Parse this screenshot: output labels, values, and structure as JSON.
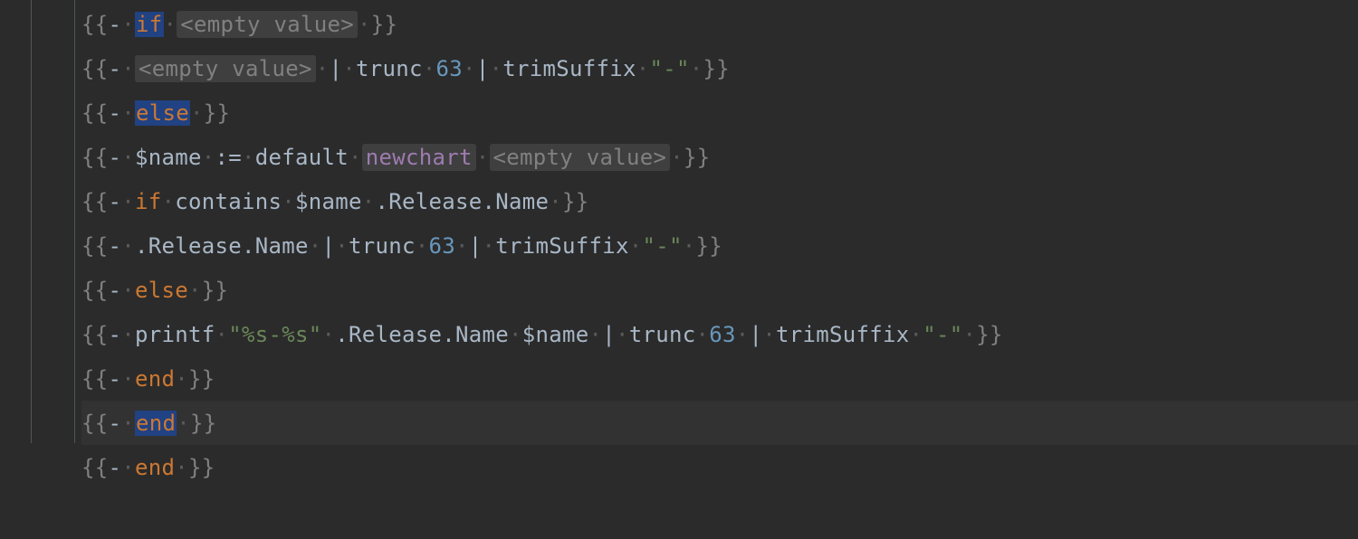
{
  "code": {
    "lines": [
      {
        "active": false,
        "tokens": [
          {
            "cls": "tok-delim",
            "text": "{{"
          },
          {
            "cls": "tok-default",
            "text": "-"
          },
          {
            "cls": "dot",
            "text": "·"
          },
          {
            "cls": "tok-keyword-hl",
            "text": "if"
          },
          {
            "cls": "dot",
            "text": "·"
          },
          {
            "cls": "tok-inlay",
            "text": "<empty value>"
          },
          {
            "cls": "dot",
            "text": "·"
          },
          {
            "cls": "tok-delim",
            "text": "}}"
          }
        ]
      },
      {
        "active": false,
        "tokens": [
          {
            "cls": "tok-delim",
            "text": "{{"
          },
          {
            "cls": "tok-default",
            "text": "-"
          },
          {
            "cls": "dot",
            "text": "·"
          },
          {
            "cls": "tok-inlay",
            "text": "<empty value>"
          },
          {
            "cls": "dot",
            "text": "·"
          },
          {
            "cls": "tok-default",
            "text": "|"
          },
          {
            "cls": "dot",
            "text": "·"
          },
          {
            "cls": "tok-func",
            "text": "trunc"
          },
          {
            "cls": "dot",
            "text": "·"
          },
          {
            "cls": "tok-number",
            "text": "63"
          },
          {
            "cls": "dot",
            "text": "·"
          },
          {
            "cls": "tok-default",
            "text": "|"
          },
          {
            "cls": "dot",
            "text": "·"
          },
          {
            "cls": "tok-func",
            "text": "trimSuffix"
          },
          {
            "cls": "dot",
            "text": "·"
          },
          {
            "cls": "tok-string",
            "text": "\"-\""
          },
          {
            "cls": "dot",
            "text": "·"
          },
          {
            "cls": "tok-delim",
            "text": "}}"
          }
        ]
      },
      {
        "active": false,
        "tokens": [
          {
            "cls": "tok-delim",
            "text": "{{"
          },
          {
            "cls": "tok-default",
            "text": "-"
          },
          {
            "cls": "dot",
            "text": "·"
          },
          {
            "cls": "tok-keyword-hl",
            "text": "else"
          },
          {
            "cls": "dot",
            "text": "·"
          },
          {
            "cls": "tok-delim",
            "text": "}}"
          }
        ]
      },
      {
        "active": false,
        "tokens": [
          {
            "cls": "tok-delim",
            "text": "{{"
          },
          {
            "cls": "tok-default",
            "text": "-"
          },
          {
            "cls": "dot",
            "text": "·"
          },
          {
            "cls": "tok-var",
            "text": "$name"
          },
          {
            "cls": "dot",
            "text": "·"
          },
          {
            "cls": "tok-default",
            "text": ":="
          },
          {
            "cls": "dot",
            "text": "·"
          },
          {
            "cls": "tok-func",
            "text": "default"
          },
          {
            "cls": "dot",
            "text": "·"
          },
          {
            "cls": "tok-inlay-val",
            "text": "newchart"
          },
          {
            "cls": "dot",
            "text": "·"
          },
          {
            "cls": "tok-inlay",
            "text": "<empty value>"
          },
          {
            "cls": "dot",
            "text": "·"
          },
          {
            "cls": "tok-delim",
            "text": "}}"
          }
        ]
      },
      {
        "active": false,
        "tokens": [
          {
            "cls": "tok-delim",
            "text": "{{"
          },
          {
            "cls": "tok-default",
            "text": "-"
          },
          {
            "cls": "dot",
            "text": "·"
          },
          {
            "cls": "tok-keyword",
            "text": "if"
          },
          {
            "cls": "dot",
            "text": "·"
          },
          {
            "cls": "tok-func",
            "text": "contains"
          },
          {
            "cls": "dot",
            "text": "·"
          },
          {
            "cls": "tok-var",
            "text": "$name"
          },
          {
            "cls": "dot",
            "text": "·"
          },
          {
            "cls": "tok-var",
            "text": ".Release.Name"
          },
          {
            "cls": "dot",
            "text": "·"
          },
          {
            "cls": "tok-delim",
            "text": "}}"
          }
        ]
      },
      {
        "active": false,
        "tokens": [
          {
            "cls": "tok-delim",
            "text": "{{"
          },
          {
            "cls": "tok-default",
            "text": "-"
          },
          {
            "cls": "dot",
            "text": "·"
          },
          {
            "cls": "tok-var",
            "text": ".Release.Name"
          },
          {
            "cls": "dot",
            "text": "·"
          },
          {
            "cls": "tok-default",
            "text": "|"
          },
          {
            "cls": "dot",
            "text": "·"
          },
          {
            "cls": "tok-func",
            "text": "trunc"
          },
          {
            "cls": "dot",
            "text": "·"
          },
          {
            "cls": "tok-number",
            "text": "63"
          },
          {
            "cls": "dot",
            "text": "·"
          },
          {
            "cls": "tok-default",
            "text": "|"
          },
          {
            "cls": "dot",
            "text": "·"
          },
          {
            "cls": "tok-func",
            "text": "trimSuffix"
          },
          {
            "cls": "dot",
            "text": "·"
          },
          {
            "cls": "tok-string",
            "text": "\"-\""
          },
          {
            "cls": "dot",
            "text": "·"
          },
          {
            "cls": "tok-delim",
            "text": "}}"
          }
        ]
      },
      {
        "active": false,
        "tokens": [
          {
            "cls": "tok-delim",
            "text": "{{"
          },
          {
            "cls": "tok-default",
            "text": "-"
          },
          {
            "cls": "dot",
            "text": "·"
          },
          {
            "cls": "tok-keyword",
            "text": "else"
          },
          {
            "cls": "dot",
            "text": "·"
          },
          {
            "cls": "tok-delim",
            "text": "}}"
          }
        ]
      },
      {
        "active": false,
        "tokens": [
          {
            "cls": "tok-delim",
            "text": "{{"
          },
          {
            "cls": "tok-default",
            "text": "-"
          },
          {
            "cls": "dot",
            "text": "·"
          },
          {
            "cls": "tok-func",
            "text": "printf"
          },
          {
            "cls": "dot",
            "text": "·"
          },
          {
            "cls": "tok-string",
            "text": "\"%s-%s\""
          },
          {
            "cls": "dot",
            "text": "·"
          },
          {
            "cls": "tok-var",
            "text": ".Release.Name"
          },
          {
            "cls": "dot",
            "text": "·"
          },
          {
            "cls": "tok-var",
            "text": "$name"
          },
          {
            "cls": "dot",
            "text": "·"
          },
          {
            "cls": "tok-default",
            "text": "|"
          },
          {
            "cls": "dot",
            "text": "·"
          },
          {
            "cls": "tok-func",
            "text": "trunc"
          },
          {
            "cls": "dot",
            "text": "·"
          },
          {
            "cls": "tok-number",
            "text": "63"
          },
          {
            "cls": "dot",
            "text": "·"
          },
          {
            "cls": "tok-default",
            "text": "|"
          },
          {
            "cls": "dot",
            "text": "·"
          },
          {
            "cls": "tok-func",
            "text": "trimSuffix"
          },
          {
            "cls": "dot",
            "text": "·"
          },
          {
            "cls": "tok-string",
            "text": "\"-\""
          },
          {
            "cls": "dot",
            "text": "·"
          },
          {
            "cls": "tok-delim",
            "text": "}}"
          }
        ]
      },
      {
        "active": false,
        "tokens": [
          {
            "cls": "tok-delim",
            "text": "{{"
          },
          {
            "cls": "tok-default",
            "text": "-"
          },
          {
            "cls": "dot",
            "text": "·"
          },
          {
            "cls": "tok-keyword",
            "text": "end"
          },
          {
            "cls": "dot",
            "text": "·"
          },
          {
            "cls": "tok-delim",
            "text": "}}"
          }
        ]
      },
      {
        "active": true,
        "tokens": [
          {
            "cls": "tok-delim",
            "text": "{{"
          },
          {
            "cls": "tok-default",
            "text": "-"
          },
          {
            "cls": "dot",
            "text": "·"
          },
          {
            "cls": "tok-keyword-hl",
            "text": "end"
          },
          {
            "cls": "dot",
            "text": "·"
          },
          {
            "cls": "tok-delim",
            "text": "}}"
          }
        ]
      },
      {
        "active": false,
        "tokens": [
          {
            "cls": "tok-delim",
            "text": "{{"
          },
          {
            "cls": "tok-default",
            "text": "-"
          },
          {
            "cls": "dot",
            "text": "·"
          },
          {
            "cls": "tok-keyword",
            "text": "end"
          },
          {
            "cls": "dot",
            "text": "·"
          },
          {
            "cls": "tok-delim",
            "text": "}}"
          }
        ]
      },
      {
        "active": false,
        "tokens": []
      }
    ]
  }
}
